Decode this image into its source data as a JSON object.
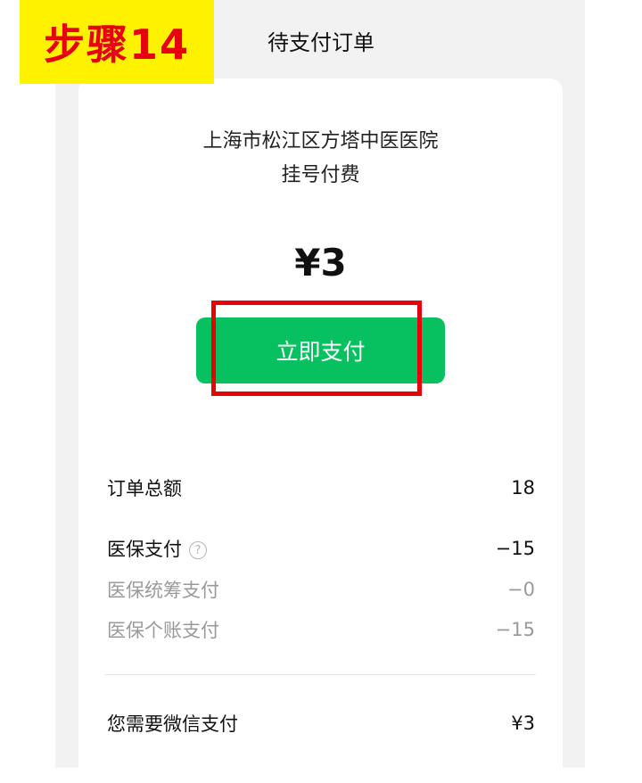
{
  "step_badge": "步骤14",
  "nav": {
    "title": "待支付订单"
  },
  "merchant": {
    "name": "上海市松江区方塔中医医院",
    "item": "挂号付费"
  },
  "amount": "¥3",
  "pay_button_label": "立即支付",
  "summary": {
    "total": {
      "label": "订单总额",
      "value": "18"
    },
    "insurance": {
      "label": "医保支付",
      "value": "−15",
      "help_icon": "question-circle"
    },
    "pooled": {
      "label": "医保统筹支付",
      "value": "−0"
    },
    "personal": {
      "label": "医保个账支付",
      "value": "−15"
    },
    "wechat": {
      "label": "您需要微信支付",
      "value": "¥3"
    }
  },
  "colors": {
    "accent": "#07c160",
    "highlight": "#e8000b",
    "badge_bg": "#fff200",
    "badge_text": "#e60012"
  }
}
